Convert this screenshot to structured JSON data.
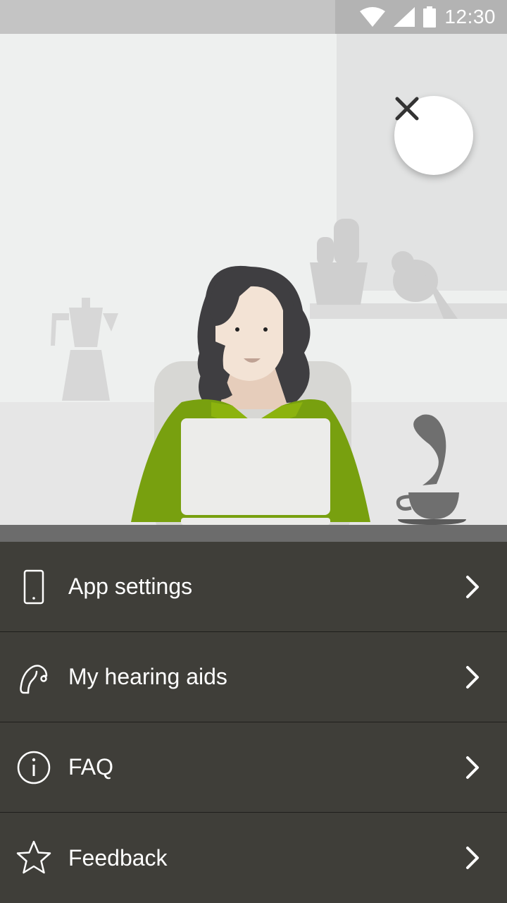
{
  "status_bar": {
    "time": "12:30",
    "icons": [
      "wifi-icon",
      "signal-icon",
      "battery-icon"
    ]
  },
  "close_button": {
    "icon": "close-icon"
  },
  "menu": {
    "items": [
      {
        "label": "App settings",
        "icon": "phone-icon"
      },
      {
        "label": "My hearing aids",
        "icon": "hearing-aid-icon"
      },
      {
        "label": "FAQ",
        "icon": "info-icon"
      },
      {
        "label": "Feedback",
        "icon": "star-icon"
      }
    ]
  },
  "colors": {
    "menu_background": "#3f3e39",
    "menu_text": "#ffffff",
    "accent_green": "#78a00f",
    "status_bar": "#c4c4c4"
  }
}
